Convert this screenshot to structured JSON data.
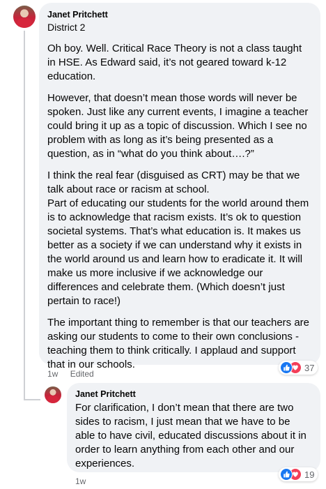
{
  "comment": {
    "author": "Janet Pritchett",
    "badge": "District 2",
    "paragraphs": [
      "Oh boy. Well. Critical Race Theory is not a class taught in HSE. As Edward said, it’s not geared toward k-12 education.",
      "However, that doesn’t mean those words will never be spoken. Just like any current events, I imagine a teacher could bring it up as a topic of discussion. Which I see no problem with as long as it’s being presented as a question, as in “what do you think about….?”",
      "I think the real fear (disguised as CRT) may be that we talk about race or racism at school.",
      "Part of educating our students for the world around them is to acknowledge that racism exists. It’s ok to question societal systems. That’s what education is. It makes us better as a society if we can understand why it exists in the world around us and learn how to eradicate it. It will make us more inclusive if we acknowledge our differences and celebrate them. (Which doesn’t just pertain to race!)",
      "The important thing to remember is that our teachers are asking our students to come to their own conclusions - teaching them to think critically. I applaud and support that in our schools."
    ],
    "time": "1w",
    "edited": "Edited",
    "reaction_count": "37",
    "reaction_icons": [
      "like-icon",
      "love-icon"
    ]
  },
  "reply": {
    "author": "Janet Pritchett",
    "text": "For clarification, I don’t mean that there are two sides to racism, I just mean that we have to be able to have civil, educated discussions about it in order to learn anything from each other and our experiences.",
    "time": "1w",
    "reaction_count": "19",
    "reaction_icons": [
      "like-icon",
      "love-icon"
    ]
  },
  "colors": {
    "bubble": "#f0f2f5",
    "meta": "#65676b",
    "like": "#1877f2",
    "love": "#f33e58"
  }
}
